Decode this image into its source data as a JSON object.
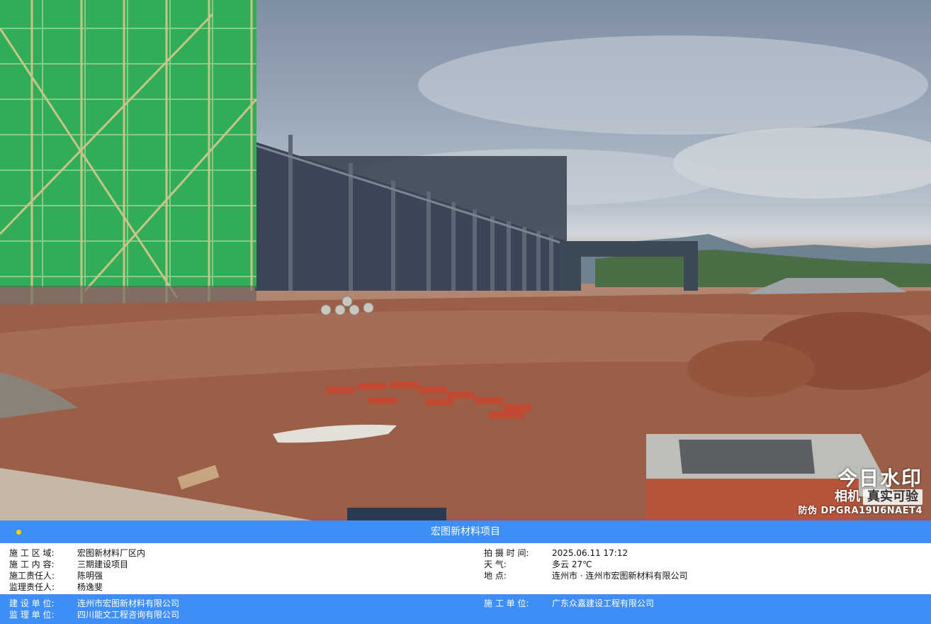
{
  "watermark": {
    "brand": "今日水印",
    "camera": "相机",
    "verified": "真实可验",
    "anti_fake": "防伪 DPGRA19U6NAET4"
  },
  "project_title": "宏图新材料项目",
  "left_info": [
    {
      "label": "施 工 区 域:",
      "value": "宏图新材料厂区内"
    },
    {
      "label": "施 工 内 容:",
      "value": "三期建设项目"
    },
    {
      "label": "施工责任人:",
      "value": "陈明强"
    },
    {
      "label": "监理责任人:",
      "value": "杨逸斐"
    }
  ],
  "right_info": [
    {
      "label": "拍 摄 时 间:",
      "value": "2025.06.11 17:12"
    },
    {
      "label": "天          气:",
      "value": "多云 27℃"
    },
    {
      "label": "地          点:",
      "value": "连州市 · 连州市宏图新材料有限公司"
    }
  ],
  "footer": {
    "left": [
      {
        "label": "建 设 单 位:",
        "value": "连州市宏图新材料有限公司"
      },
      {
        "label": "监 理 单 位:",
        "value": "四川能文工程咨询有限公司"
      }
    ],
    "right": [
      {
        "label": "施 工 单 位:",
        "value": "广东众嘉建设工程有限公司"
      }
    ]
  },
  "colors": {
    "bar": "#3d8ef7",
    "dot": "#ffd200"
  }
}
